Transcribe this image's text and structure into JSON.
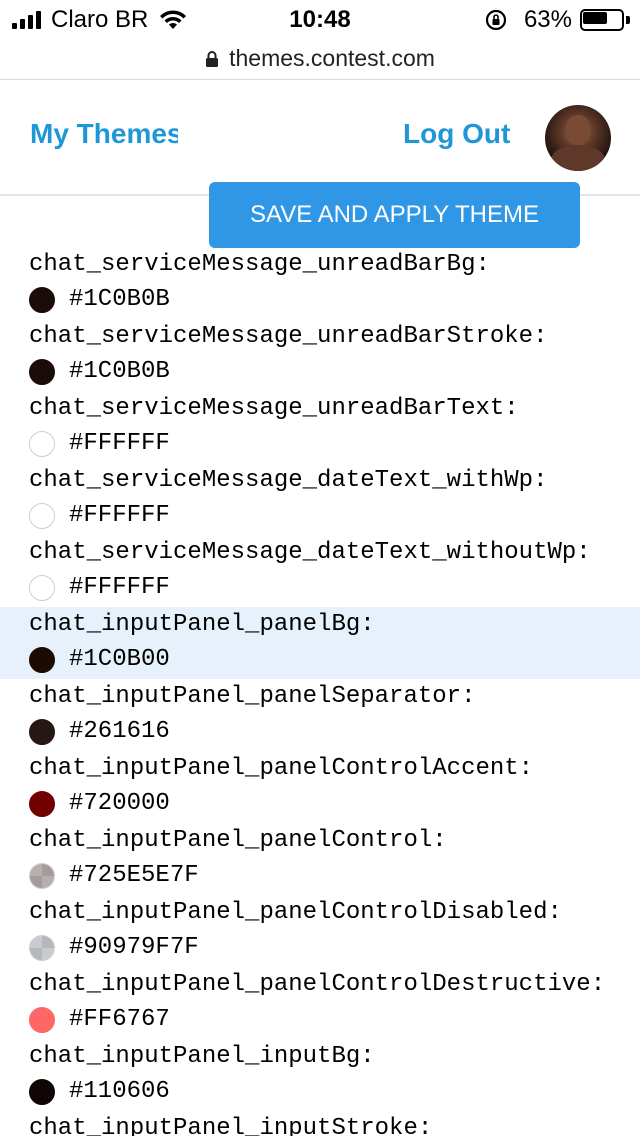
{
  "status_bar": {
    "carrier": "Claro BR",
    "time": "10:48",
    "battery": "63%",
    "battery_level": 0.63
  },
  "url_bar": {
    "url": "themes.contest.com"
  },
  "header": {
    "my_themes": "My Themes",
    "log_out": "Log Out"
  },
  "save_button": "SAVE AND APPLY THEME",
  "items": [
    {
      "name": "chat_serviceMessage_unreadBarBg:",
      "value": "#1C0B0B",
      "color": "#1C0B0B"
    },
    {
      "name": "chat_serviceMessage_unreadBarStroke:",
      "value": "#1C0B0B",
      "color": "#1C0B0B"
    },
    {
      "name": "chat_serviceMessage_unreadBarText:",
      "value": "#FFFFFF",
      "color": "#FFFFFF"
    },
    {
      "name": "chat_serviceMessage_dateText_withWp:",
      "value": "#FFFFFF",
      "color": "#FFFFFF"
    },
    {
      "name": "chat_serviceMessage_dateText_withoutWp:",
      "value": "#FFFFFF",
      "color": "#FFFFFF"
    },
    {
      "name": "chat_inputPanel_panelBg:",
      "value": "#1C0B00",
      "color": "#1C0B00",
      "highlighted": true
    },
    {
      "name": "chat_inputPanel_panelSeparator:",
      "value": "#261616",
      "color": "#261616"
    },
    {
      "name": "chat_inputPanel_panelControlAccent:",
      "value": "#720000",
      "color": "#720000"
    },
    {
      "name": "chat_inputPanel_panelControl:",
      "value": "#725E5E7F",
      "color": "#725E5E",
      "translucent": true
    },
    {
      "name": "chat_inputPanel_panelControlDisabled:",
      "value": "#90979F7F",
      "color": "#90979F",
      "translucent": true
    },
    {
      "name": "chat_inputPanel_panelControlDestructive:",
      "value": "#FF6767",
      "color": "#FF6767"
    },
    {
      "name": "chat_inputPanel_inputBg:",
      "value": "#110606",
      "color": "#110606"
    },
    {
      "name": "chat_inputPanel_inputStroke:",
      "value": "",
      "color": ""
    }
  ]
}
